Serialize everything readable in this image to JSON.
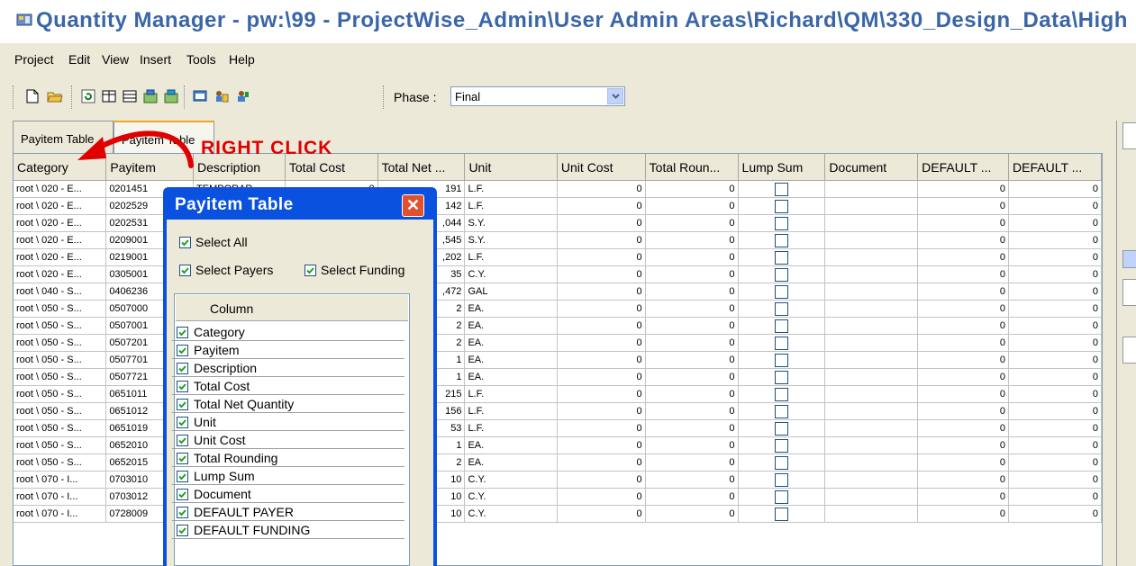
{
  "window": {
    "title": "Quantity Manager - pw:\\99 - ProjectWise_Admin\\User Admin Areas\\Richard\\QM\\330_Design_Data\\High"
  },
  "menu": [
    "Project",
    "Edit",
    "View",
    "Insert",
    "Tools",
    "Help"
  ],
  "toolbar": {
    "icons": [
      "new-document-icon",
      "open-folder-icon",
      "refresh-icon",
      "table-icon",
      "list-icon",
      "insert-row-icon",
      "delete-row-icon",
      "export-icon",
      "payer-icon",
      "funding-icon"
    ],
    "phase_label": "Phase :",
    "phase_value": "Final"
  },
  "tabs": [
    "Payitem Table",
    "Payitem Table"
  ],
  "annotation": {
    "text": "RIGHT CLICK",
    "color": "#e10000"
  },
  "grid": {
    "columns": [
      "Category",
      "Payitem",
      "Description",
      "Total Cost",
      "Total Net ...",
      "Unit",
      "Unit Cost",
      "Total Roun...",
      "Lump Sum",
      "Document",
      "DEFAULT ...",
      "DEFAULT ..."
    ],
    "first_description": "TEMPORAR",
    "rows": [
      {
        "category": "root \\ 020 - E...",
        "payitem": "0201451",
        "qty": "191",
        "unit": "L.F."
      },
      {
        "category": "root \\ 020 - E...",
        "payitem": "0202529",
        "qty": "142",
        "unit": "L.F."
      },
      {
        "category": "root \\ 020 - E...",
        "payitem": "0202531",
        "qty": ",044",
        "unit": "S.Y."
      },
      {
        "category": "root \\ 020 - E...",
        "payitem": "0209001",
        "qty": ",545",
        "unit": "S.Y."
      },
      {
        "category": "root \\ 020 - E...",
        "payitem": "0219001",
        "qty": ",202",
        "unit": "L.F."
      },
      {
        "category": "root \\ 020 - E...",
        "payitem": "0305001",
        "qty": "35",
        "unit": "C.Y."
      },
      {
        "category": "root \\ 040 - S...",
        "payitem": "0406236",
        "qty": ",472",
        "unit": "GAL"
      },
      {
        "category": "root \\ 050 - S...",
        "payitem": "0507000",
        "qty": "2",
        "unit": "EA."
      },
      {
        "category": "root \\ 050 - S...",
        "payitem": "0507001",
        "qty": "2",
        "unit": "EA."
      },
      {
        "category": "root \\ 050 - S...",
        "payitem": "0507201",
        "qty": "2",
        "unit": "EA."
      },
      {
        "category": "root \\ 050 - S...",
        "payitem": "0507701",
        "qty": "1",
        "unit": "EA."
      },
      {
        "category": "root \\ 050 - S...",
        "payitem": "0507721",
        "qty": "1",
        "unit": "EA."
      },
      {
        "category": "root \\ 050 - S...",
        "payitem": "0651011",
        "qty": "215",
        "unit": "L.F."
      },
      {
        "category": "root \\ 050 - S...",
        "payitem": "0651012",
        "qty": "156",
        "unit": "L.F."
      },
      {
        "category": "root \\ 050 - S...",
        "payitem": "0651019",
        "qty": "53",
        "unit": "L.F."
      },
      {
        "category": "root \\ 050 - S...",
        "payitem": "0652010",
        "qty": "1",
        "unit": "EA."
      },
      {
        "category": "root \\ 050 - S...",
        "payitem": "0652015",
        "qty": "2",
        "unit": "EA."
      },
      {
        "category": "root \\ 070 - I...",
        "payitem": "0703010",
        "qty": "10",
        "unit": "C.Y."
      },
      {
        "category": "root \\ 070 - I...",
        "payitem": "0703012",
        "qty": "10",
        "unit": "C.Y."
      },
      {
        "category": "root \\ 070 - I...",
        "payitem": "0728009",
        "qty": "10",
        "unit": "C.Y."
      }
    ],
    "zero": "0"
  },
  "dialog": {
    "title": "Payitem Table",
    "select_all": "Select All",
    "select_payers": "Select Payers",
    "select_funding": "Select Funding",
    "column_header": "Column",
    "columns": [
      "Category",
      "Payitem",
      "Description",
      "Total Cost",
      "Total Net Quantity",
      "Unit",
      "Unit Cost",
      "Total Rounding",
      "Lump Sum",
      "Document",
      "DEFAULT PAYER",
      "DEFAULT FUNDING"
    ]
  }
}
